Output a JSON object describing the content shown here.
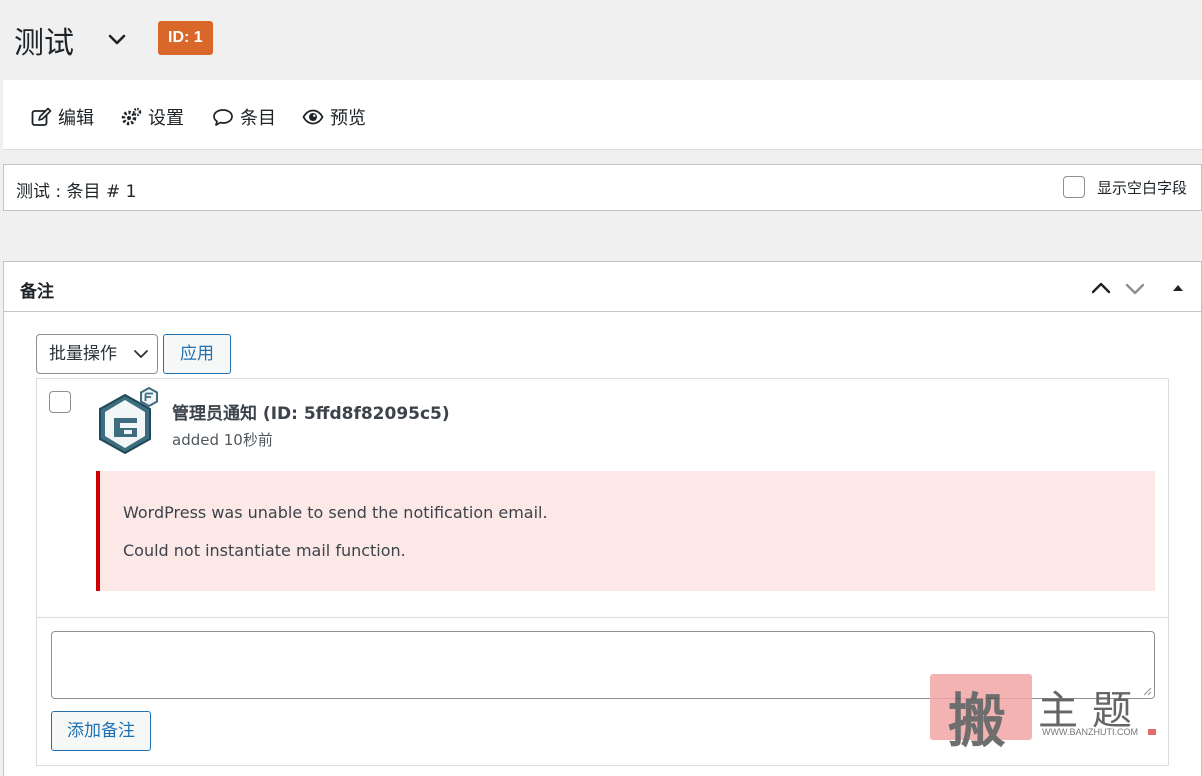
{
  "header": {
    "form_title": "测试",
    "id_badge": "ID: 1",
    "colors": {
      "badge": "#d9672a"
    }
  },
  "toolbar": {
    "items": [
      {
        "label": "编辑",
        "icon": "edit-icon"
      },
      {
        "label": "设置",
        "icon": "gear-icon"
      },
      {
        "label": "条目",
        "icon": "comment-icon"
      },
      {
        "label": "预览",
        "icon": "eye-icon"
      }
    ]
  },
  "entry_bar": {
    "title": "测试 : 条目 # 1",
    "show_empty_label": "显示空白字段"
  },
  "notes_panel": {
    "title": "备注",
    "bulk_action": "批量操作",
    "apply_label": "应用",
    "note": {
      "author": "管理员通知 (ID: 5ffd8f82095c5)",
      "time": "added 10秒前",
      "error_lines": [
        "WordPress was unable to send the notification email.",
        "Could not instantiate mail function."
      ]
    },
    "textarea_value": "",
    "add_note_label": "添加备注"
  },
  "watermark": {
    "seal_char": "搬",
    "chars": "主题",
    "url": "WWW.BANZHUTI.COM"
  }
}
